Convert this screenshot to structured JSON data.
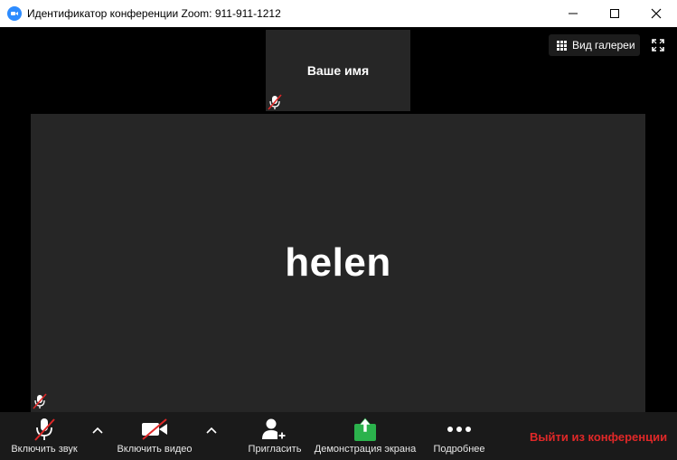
{
  "window": {
    "title": "Идентификатор конференции Zoom: 911-911-1212",
    "controls": [
      "minimize-icon",
      "maximize-icon",
      "close-icon"
    ]
  },
  "stage": {
    "self_tile": {
      "name": "Ваше имя",
      "muted": true
    },
    "main_tile": {
      "name": "helen",
      "muted": true
    },
    "gallery_button_label": "Вид галереи"
  },
  "toolbar": {
    "audio_label": "Включить звук",
    "video_label": "Включить видео",
    "invite_label": "Пригласить",
    "share_label": "Демонстрация экрана",
    "more_label": "Подробнее",
    "leave_label": "Выйти из конференции"
  },
  "colors": {
    "accent_blue": "#2d8cff",
    "share_green": "#2bb24c",
    "leave_red": "#e02828",
    "muted_red": "#e02828",
    "tile_bg": "#262626"
  }
}
